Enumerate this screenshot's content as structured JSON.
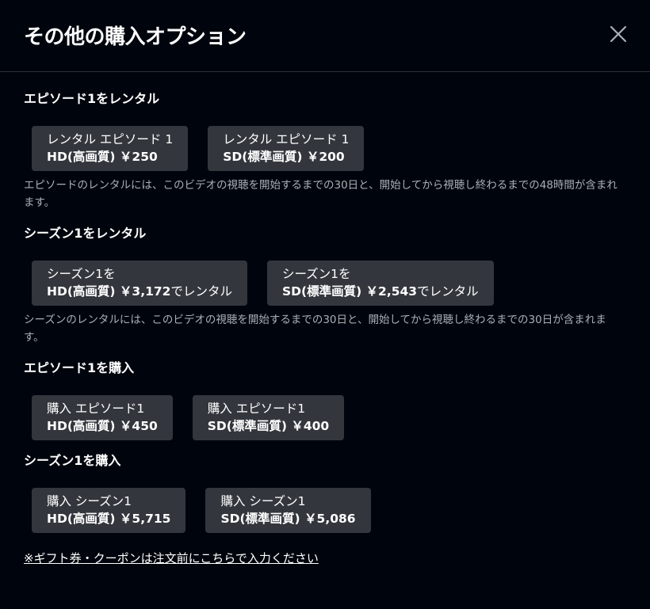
{
  "dialog": {
    "title": "その他の購入オプション",
    "close_icon": "close-icon"
  },
  "sections": [
    {
      "title": "エピソード1をレンタル",
      "options": [
        {
          "line1": "レンタル エピソード 1",
          "line2": "HD(高画質) ￥250",
          "suffix": ""
        },
        {
          "line1": "レンタル エピソード 1",
          "line2": "SD(標準画質) ￥200",
          "suffix": ""
        }
      ],
      "note": "エピソードのレンタルには、このビデオの視聴を開始するまでの30日と、開始してから視聴し終わるまでの48時間が含まれます。"
    },
    {
      "title": "シーズン1をレンタル",
      "options": [
        {
          "line1": "シーズン1を",
          "line2": "HD(高画質) ￥3,172",
          "suffix": "でレンタル"
        },
        {
          "line1": "シーズン1を",
          "line2": "SD(標準画質) ￥2,543",
          "suffix": "でレンタル"
        }
      ],
      "note": "シーズンのレンタルには、このビデオの視聴を開始するまでの30日と、開始してから視聴し終わるまでの30日が含まれます。"
    },
    {
      "title": "エピソード1を購入",
      "options": [
        {
          "line1": "購入 エピソード1",
          "line2": "HD(高画質) ￥450",
          "suffix": ""
        },
        {
          "line1": "購入 エピソード1",
          "line2": "SD(標準画質) ￥400",
          "suffix": ""
        }
      ],
      "note": ""
    },
    {
      "title": "シーズン1を購入",
      "options": [
        {
          "line1": "購入 シーズン1",
          "line2": "HD(高画質) ￥5,715",
          "suffix": ""
        },
        {
          "line1": "購入 シーズン1",
          "line2": "SD(標準画質) ￥5,086",
          "suffix": ""
        }
      ],
      "note": ""
    }
  ],
  "gift_link": "※ギフト券・クーポンは注文前にこちらで入力ください",
  "colors": {
    "background": "#00050d",
    "button": "#33373d",
    "note_text": "#aab0b6",
    "divider": "#303337"
  }
}
